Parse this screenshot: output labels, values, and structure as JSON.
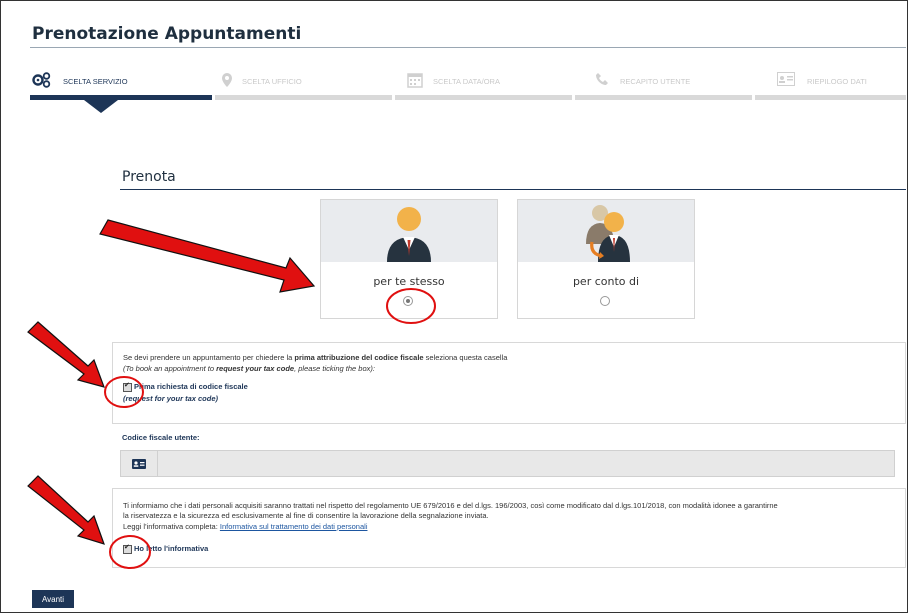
{
  "page": {
    "title": "Prenotazione Appuntamenti"
  },
  "steps": [
    {
      "label": "SCELTA SERVIZIO",
      "icon": "gears-icon",
      "active": true
    },
    {
      "label": "SCELTA UFFICIO",
      "icon": "map-pin-icon",
      "active": false
    },
    {
      "label": "SCELTA DATA/ORA",
      "icon": "calendar-icon",
      "active": false
    },
    {
      "label": "RECAPITO UTENTE",
      "icon": "phone-icon",
      "active": false
    },
    {
      "label": "RIEPILOGO DATI",
      "icon": "id-card-icon",
      "active": false
    }
  ],
  "prenota": {
    "title": "Prenota",
    "option_self": {
      "label": "per te stesso",
      "selected": true
    },
    "option_other": {
      "label": "per conto di",
      "selected": false
    }
  },
  "tax_code_box": {
    "line1_pre": "Se devi prendere un appuntamento per chiedere la ",
    "line1_bold": "prima attribuzione del codice fiscale",
    "line1_post": " seleziona questa casella",
    "line2_pre": "(To book an appointment to ",
    "line2_bold": "request your tax code",
    "line2_post": ", please ticking the box):",
    "checkbox_label": "Prima richiesta di codice fiscale",
    "checkbox_sublabel": "(request for your tax code)",
    "checked": true
  },
  "codice_fiscale": {
    "label": "Codice fiscale utente:",
    "value": ""
  },
  "privacy_box": {
    "line1": "Ti informiamo che i dati personali acquisiti saranno trattati nel rispetto del regolamento UE 679/2016 e del d.lgs. 196/2003, così come modificato dal d.lgs.101/2018, con modalità idonee a garantirne",
    "line2": "la riservatezza e la sicurezza ed esclusivamente al fine di consentire la lavorazione della segnalazione inviata.",
    "line3_pre": "Leggi l'informativa completa: ",
    "link": "Informativa sul trattamento dei dati personali",
    "checkbox_label": "Ho letto l'informativa",
    "checked": true
  },
  "actions": {
    "next_label": "Avanti"
  },
  "colors": {
    "primary": "#1d3557",
    "annotation_red": "#e01010",
    "inactive": "#d9d9d9"
  }
}
